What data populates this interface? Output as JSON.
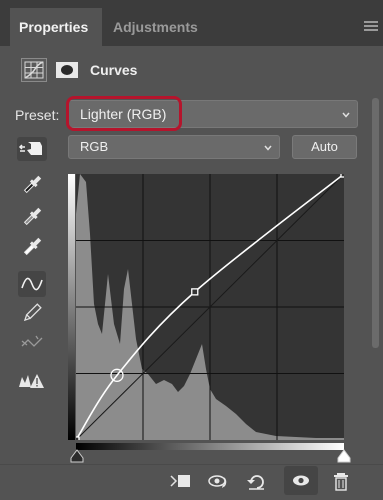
{
  "tabs": [
    {
      "label": "Properties",
      "active": true
    },
    {
      "label": "Adjustments",
      "active": false
    }
  ],
  "header": {
    "title": "Curves",
    "icons": [
      "curves-adjustment-icon",
      "layer-mask-icon"
    ]
  },
  "preset": {
    "label": "Preset:",
    "value": "Lighter (RGB)"
  },
  "channel": {
    "value": "RGB"
  },
  "auto_label": "Auto",
  "tools": [
    "on-image-target-adjustment-icon",
    "black-point-eyedropper-icon",
    "gray-point-eyedropper-icon",
    "white-point-eyedropper-icon",
    "edit-points-curve-icon",
    "pencil-draw-icon",
    "smooth-curve-icon",
    "clipping-warning-icon"
  ],
  "curve": {
    "control_points": [
      [
        0,
        0
      ],
      [
        39,
        62
      ],
      [
        113,
        142
      ],
      [
        255,
        255
      ]
    ],
    "grid_divisions": 4
  },
  "colors": {
    "panel": "#535353",
    "tabbar": "#3c3c3c",
    "highlight_ring": "#b5142c"
  },
  "bottom_icons": [
    "clip-to-layer-icon",
    "view-previous-state-icon",
    "reset-adjustment-icon",
    "toggle-visibility-icon",
    "delete-icon"
  ]
}
